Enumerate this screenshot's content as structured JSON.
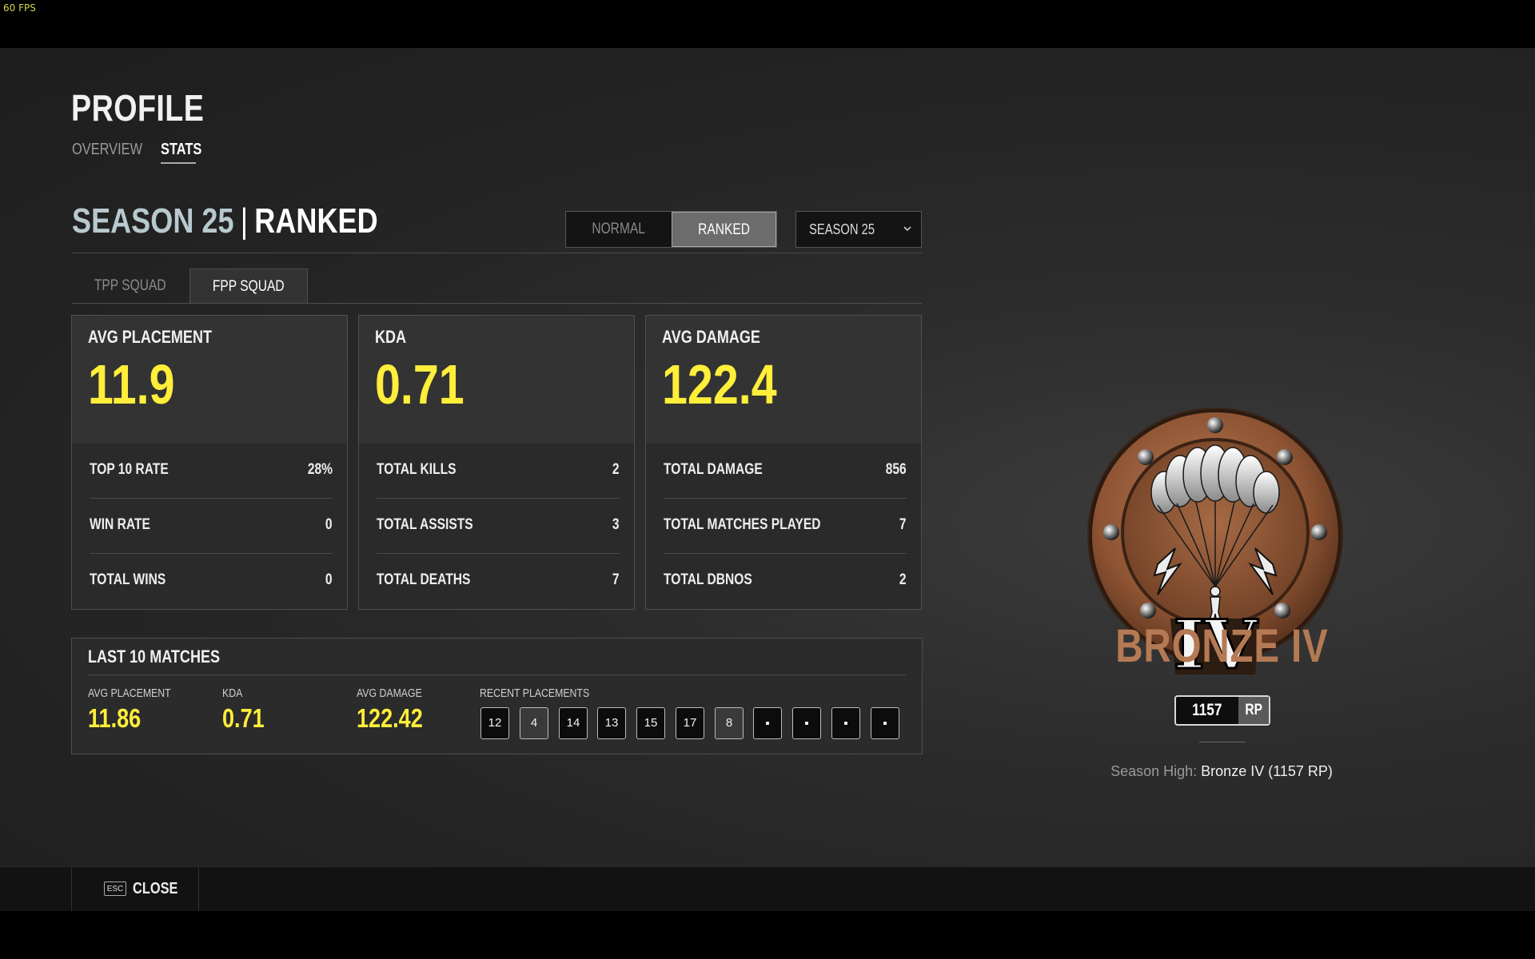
{
  "overlay": {
    "fps": "60 FPS"
  },
  "page": {
    "title": "PROFILE",
    "tabs": [
      {
        "label": "OVERVIEW"
      },
      {
        "label": "STATS"
      }
    ]
  },
  "header": {
    "season": "SEASON 25",
    "separator": "|",
    "mode": "RANKED",
    "mode_toggle": [
      {
        "label": "NORMAL"
      },
      {
        "label": "RANKED"
      }
    ],
    "season_select": {
      "selected": "SEASON 25"
    }
  },
  "sub_tabs": [
    {
      "label": "TPP SQUAD"
    },
    {
      "label": "FPP SQUAD"
    }
  ],
  "cards": [
    {
      "title": "AVG PLACEMENT",
      "value": "11.9",
      "rows": [
        {
          "name": "TOP 10 RATE",
          "value": "28%"
        },
        {
          "name": "WIN RATE",
          "value": "0"
        },
        {
          "name": "TOTAL WINS",
          "value": "0"
        }
      ]
    },
    {
      "title": "KDA",
      "value": "0.71",
      "rows": [
        {
          "name": "TOTAL KILLS",
          "value": "2"
        },
        {
          "name": "TOTAL ASSISTS",
          "value": "3"
        },
        {
          "name": "TOTAL DEATHS",
          "value": "7"
        }
      ]
    },
    {
      "title": "AVG DAMAGE",
      "value": "122.4",
      "rows": [
        {
          "name": "TOTAL DAMAGE",
          "value": "856"
        },
        {
          "name": "TOTAL MATCHES PLAYED",
          "value": "7"
        },
        {
          "name": "TOTAL DBNOS",
          "value": "2"
        }
      ]
    }
  ],
  "last10": {
    "title": "LAST 10 MATCHES",
    "stats": [
      {
        "label": "AVG PLACEMENT",
        "value": "11.86"
      },
      {
        "label": "KDA",
        "value": "0.71"
      },
      {
        "label": "AVG DAMAGE",
        "value": "122.42"
      }
    ],
    "recent_label": "RECENT PLACEMENTS",
    "placements": [
      "12",
      "4",
      "14",
      "13",
      "15",
      "17",
      "8",
      "",
      "",
      "",
      ""
    ]
  },
  "rank": {
    "name": "BRONZE IV",
    "emblem_numeral": "IV",
    "emblem_icon": "parachute-badge-icon",
    "rp_value": "1157",
    "rp_unit": "RP",
    "season_high_label": "Season High:",
    "season_high_value": "Bronze IV (1157 RP)"
  },
  "footer": {
    "esc_key": "ESC",
    "close_label": "CLOSE"
  },
  "colors": {
    "accent_yellow": "#ffee3a",
    "bronze": "#b57a54",
    "season_blue": "#b8c9cf",
    "fps_yellow": "#d8d44a"
  }
}
